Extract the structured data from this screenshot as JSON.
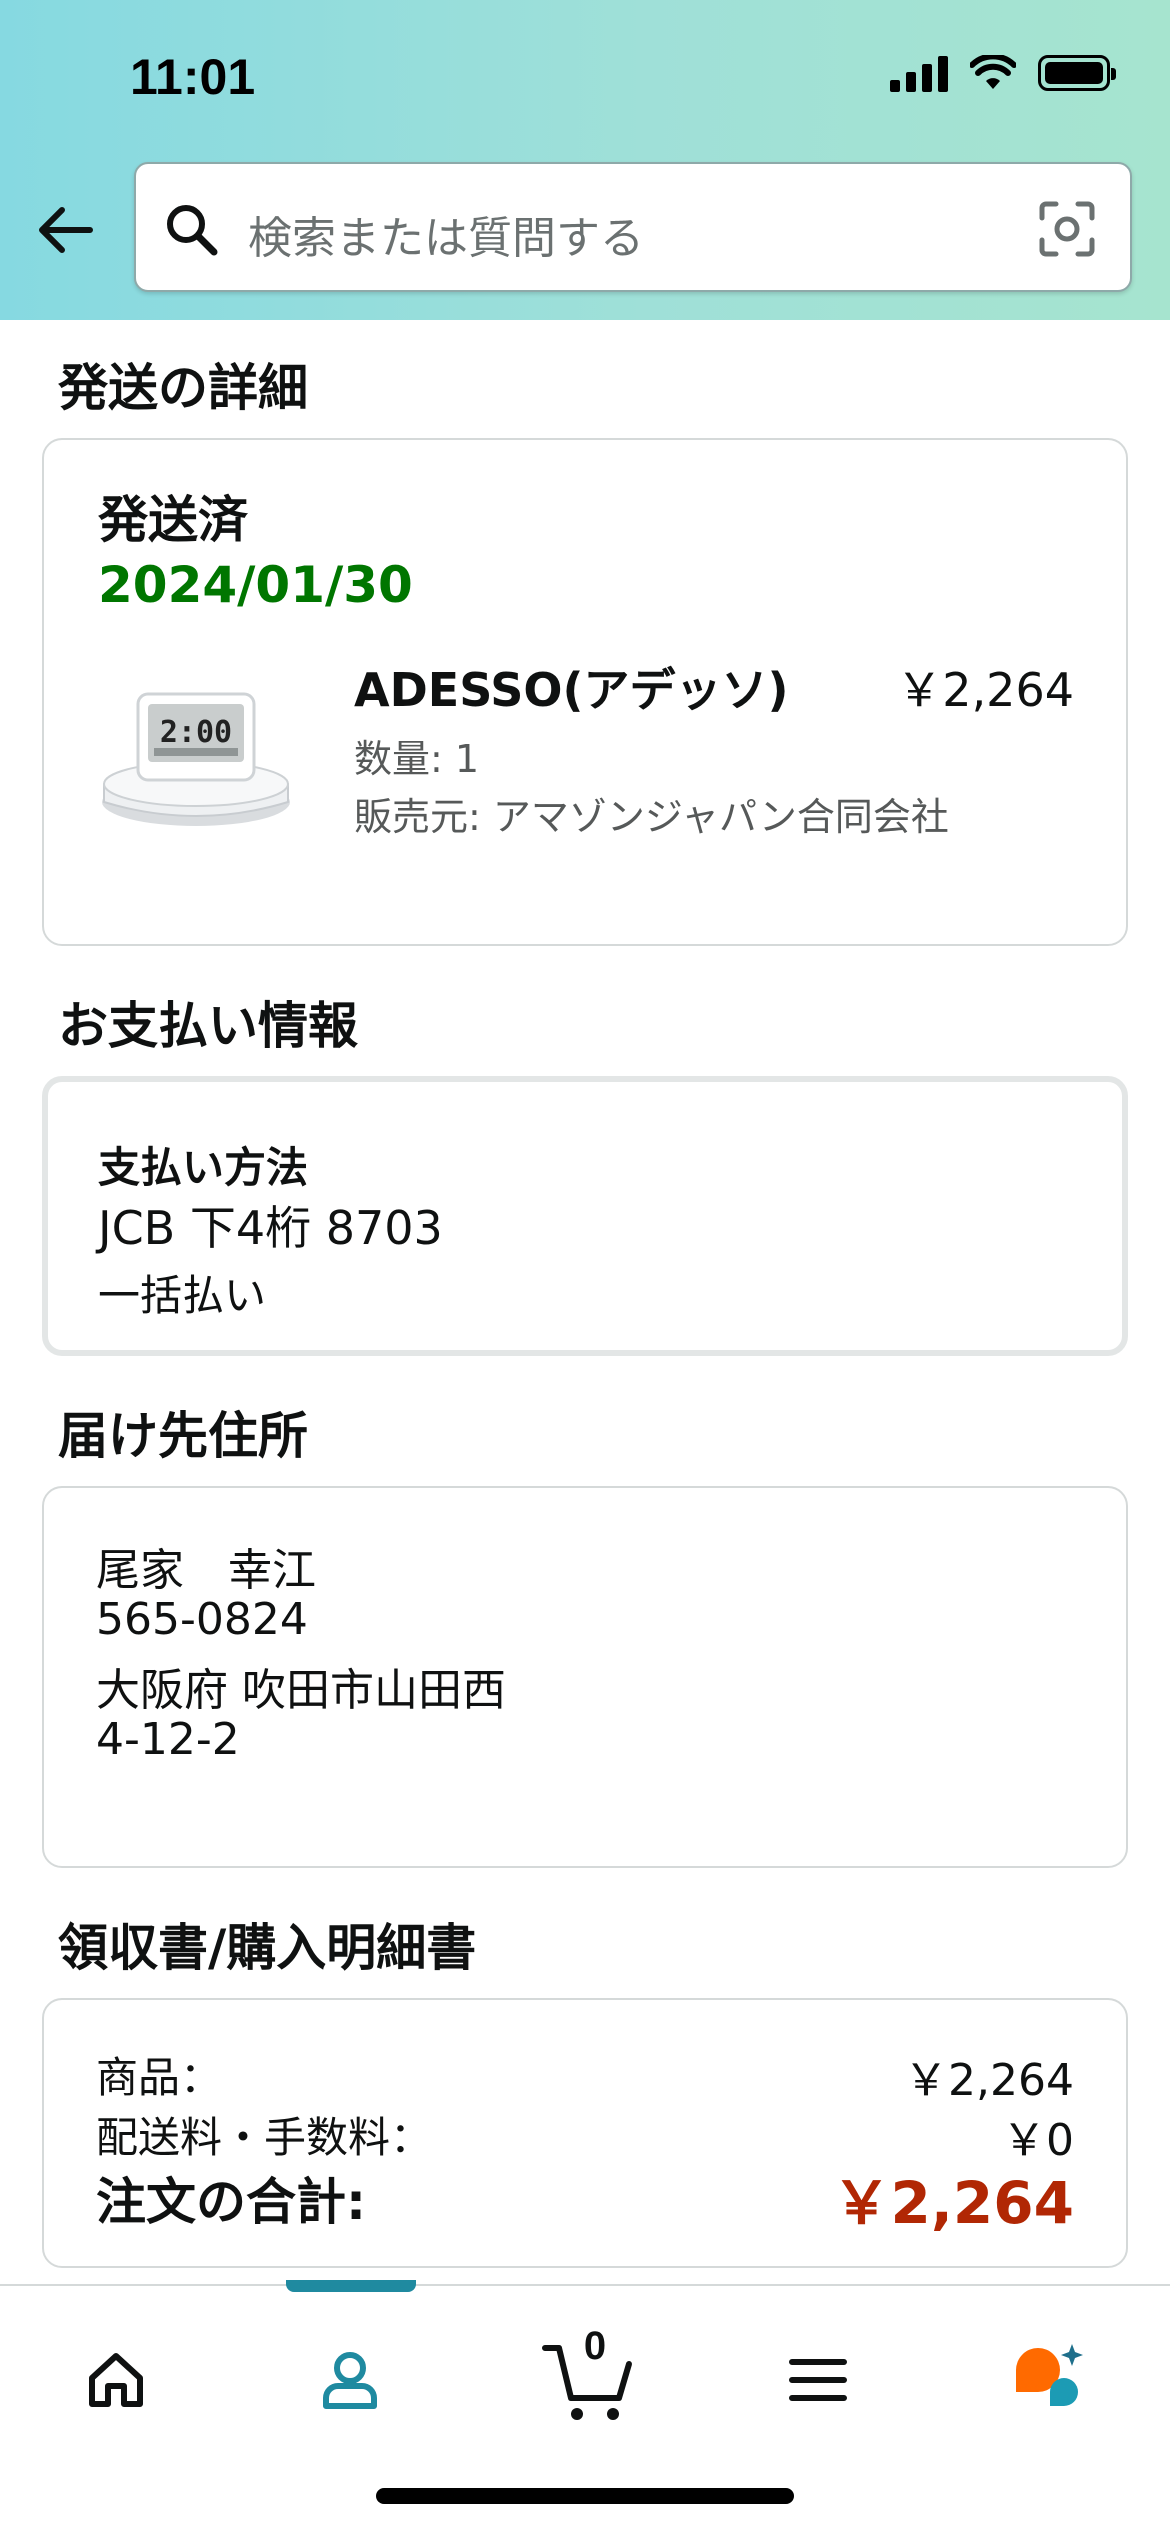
{
  "status_bar": {
    "time": "11:01"
  },
  "search": {
    "placeholder": "検索または質問する"
  },
  "shipping": {
    "section_title": "発送の詳細",
    "status": "発送済",
    "date": "2024/01/30",
    "product": {
      "title": "ADESSO(アデッソ)",
      "price": "￥2,264",
      "quantity": "数量: 1",
      "seller": "販売元: アマゾンジャパン合同会社",
      "clock_display": "2:00"
    }
  },
  "payment": {
    "section_title": "お支払い情報",
    "label": "支払い方法",
    "card": "JCB 下4桁 8703",
    "plan": "一括払い"
  },
  "address": {
    "section_title": "届け先住所",
    "lines": [
      "尾家　幸江",
      "565-0824",
      "大阪府 吹田市山田西",
      "4-12-2"
    ]
  },
  "receipt": {
    "section_title": "領収書/購入明細書",
    "items_label": "商品：",
    "items_value": "￥2,264",
    "shipping_label": "配送料・手数料：",
    "shipping_value": "￥0",
    "total_label": "注文の合計:",
    "total_value": "￥2,264"
  },
  "nav": {
    "cart_count": "0",
    "active": "account",
    "accent_color": "#1f8aa0"
  },
  "colors": {
    "date_green": "#007600",
    "total_red": "#b12704",
    "rufus_orange": "#ff6a00",
    "rufus_teal": "#1c9bb4"
  }
}
